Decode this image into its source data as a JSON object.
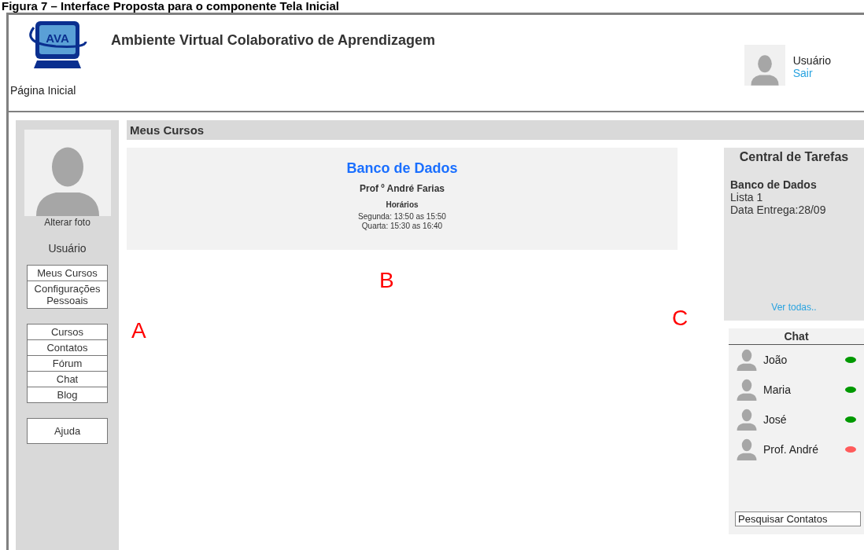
{
  "caption": "Figura 7 – Interface Proposta para o componente Tela Inicial",
  "header": {
    "logo_text": "AVA",
    "title": "Ambiente Virtual Colaborativo de Aprendizagem",
    "breadcrumb": "Página Inicial",
    "user": {
      "name": "Usuário",
      "logout": "Sair"
    }
  },
  "sidebar": {
    "photo_link": "Alterar foto",
    "user_name": "Usuário",
    "menu_groups": [
      [
        "Meus Cursos",
        "Configurações Pessoais"
      ],
      [
        "Cursos",
        "Contatos",
        "Fórum",
        "Chat",
        "Blog"
      ],
      [
        "Ajuda"
      ]
    ]
  },
  "main": {
    "section_title": "Meus Cursos",
    "course": {
      "title": "Banco de Dados",
      "teacher": "Prof º André Farias",
      "schedule_label": "Horários",
      "schedule": [
        "Segunda: 13:50 as 15:50",
        "Quarta: 15:30 as 16:40"
      ]
    }
  },
  "tasks": {
    "title": "Central de Tarefas",
    "items": [
      {
        "course": "Banco de Dados",
        "name": "Lista 1",
        "due": "Data Entrega:28/09"
      }
    ],
    "more_link": "Ver todas.."
  },
  "chat": {
    "title": "Chat",
    "contacts": [
      {
        "name": "João",
        "color": "#009900"
      },
      {
        "name": "Maria",
        "color": "#009900"
      },
      {
        "name": "José",
        "color": "#009900"
      },
      {
        "name": "Prof. André",
        "color": "#ff5b5b"
      }
    ],
    "search_placeholder": "Pesquisar Contatos"
  },
  "annotations": [
    "A",
    "B",
    "C"
  ]
}
